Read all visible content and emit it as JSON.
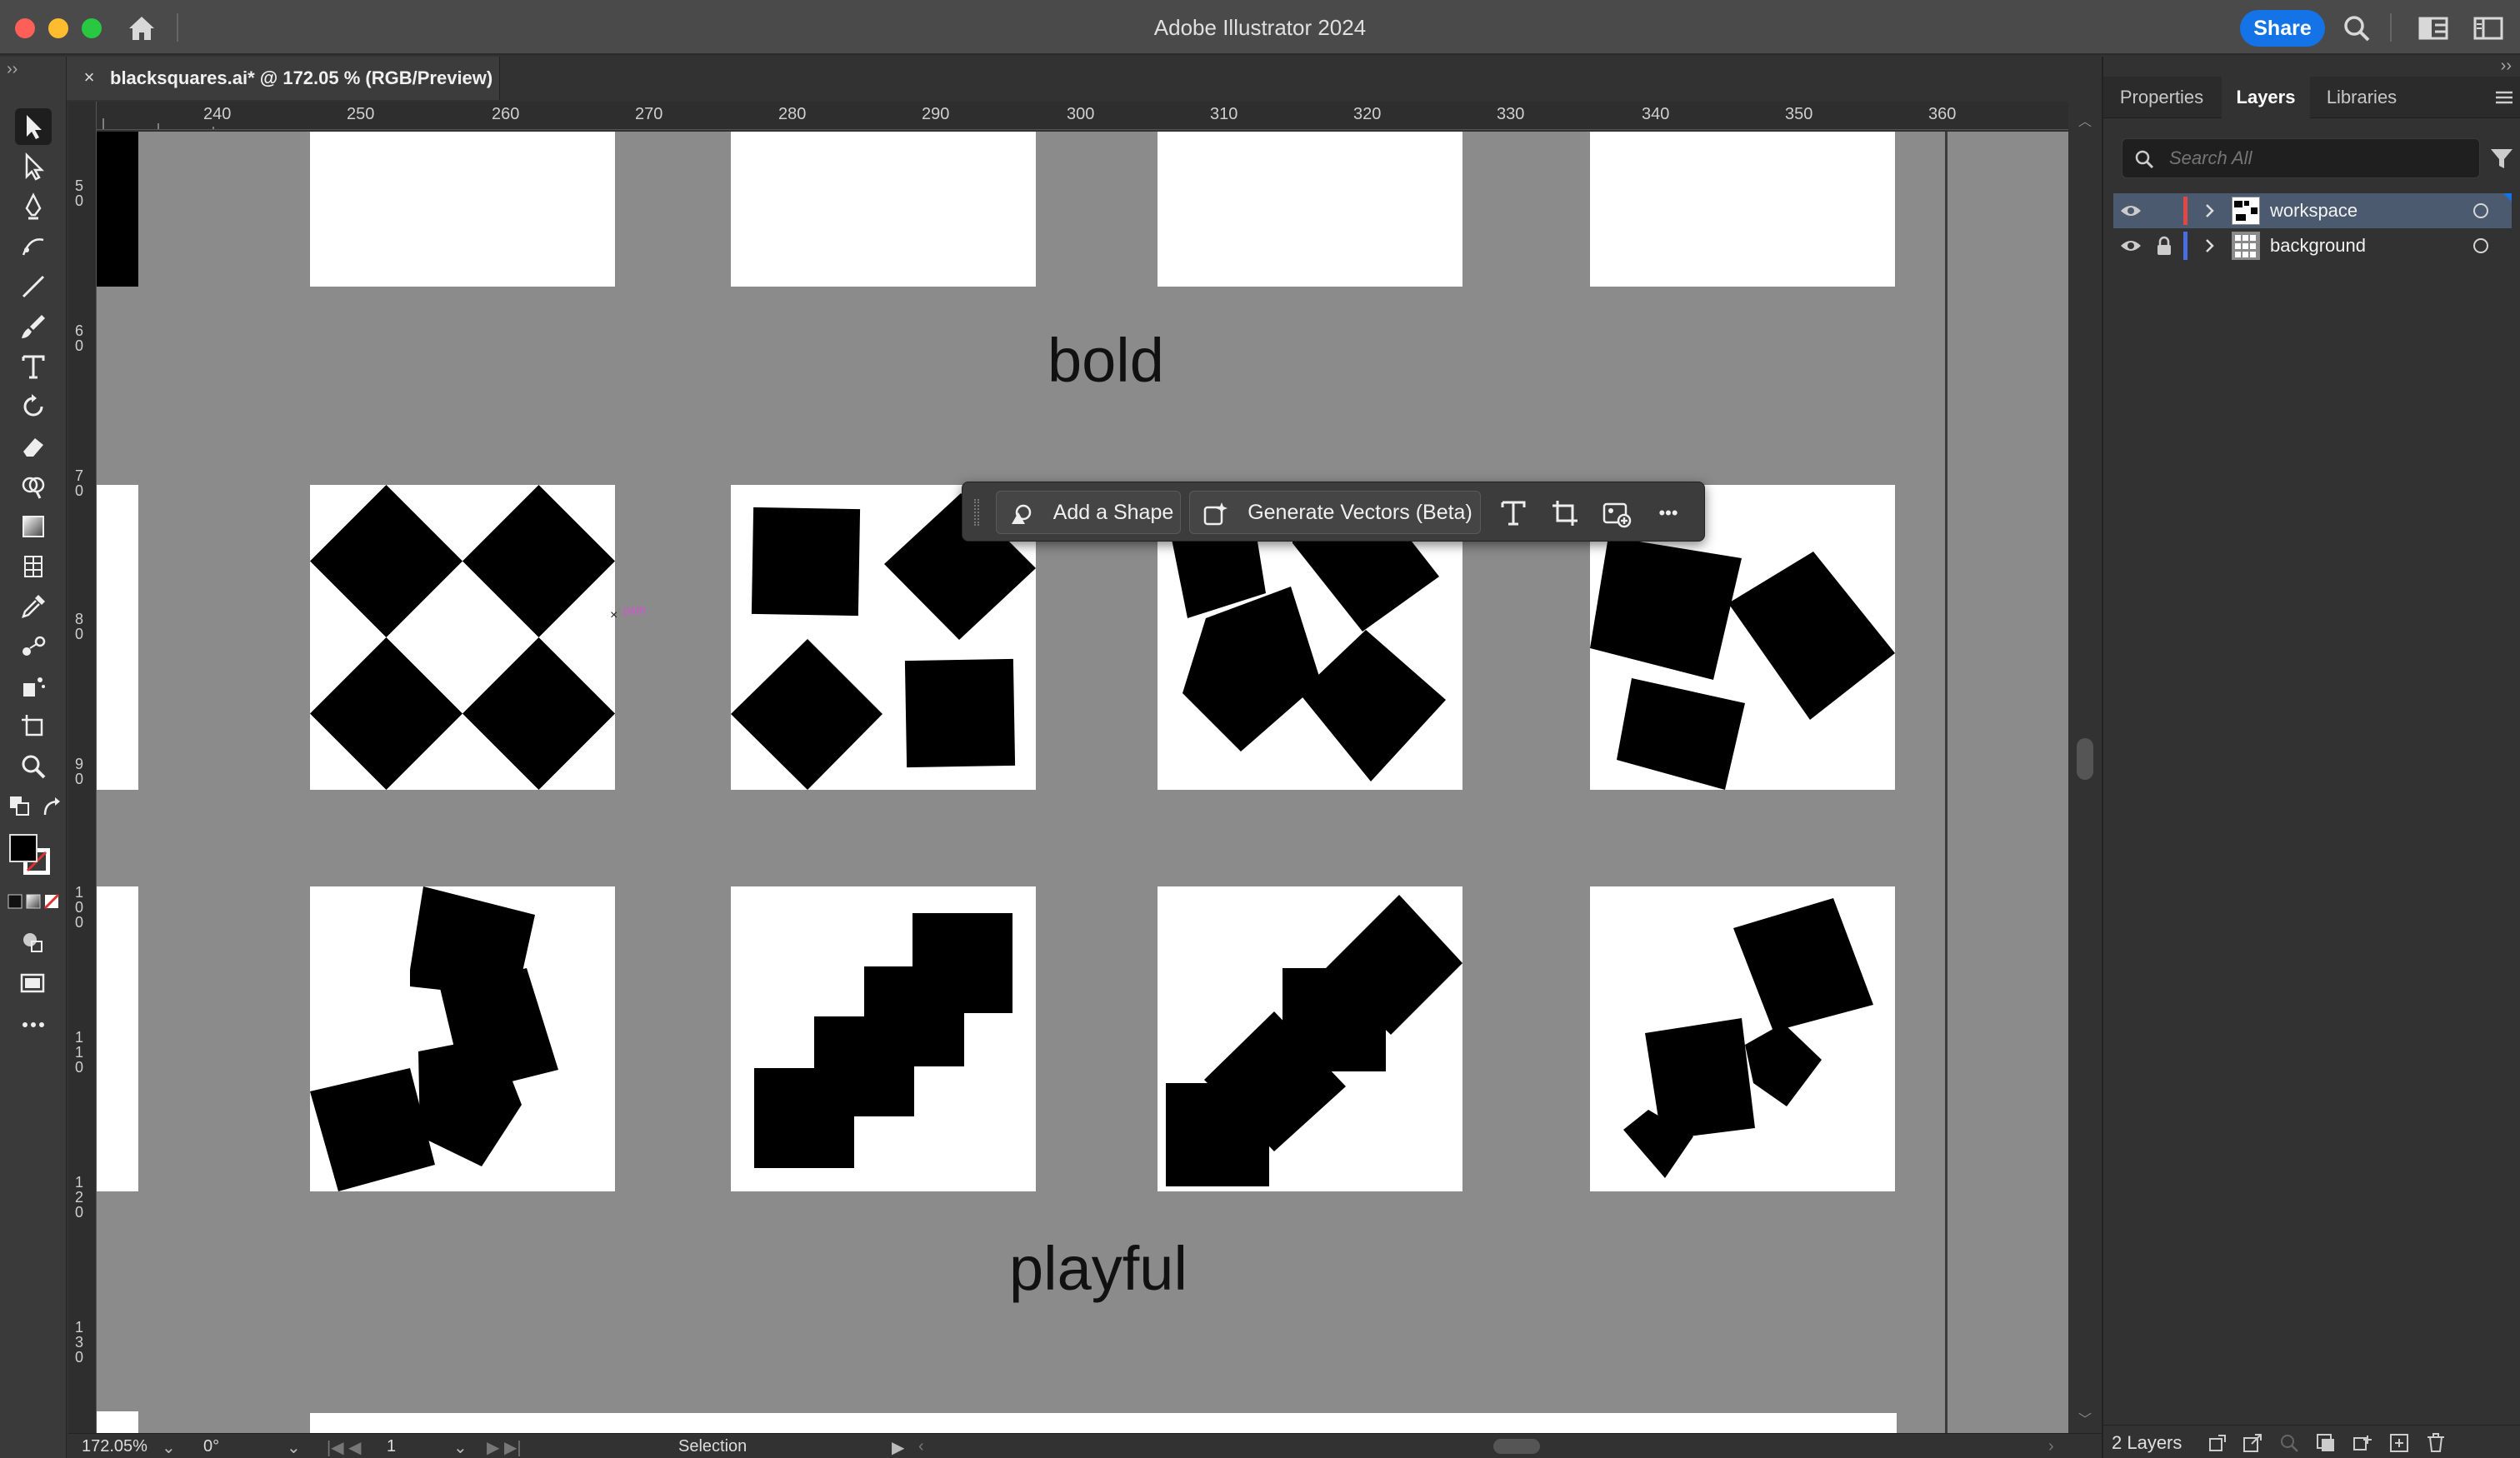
{
  "app": {
    "title": "Adobe Illustrator 2024",
    "share_label": "Share"
  },
  "document": {
    "tab_label": "blacksquares.ai* @ 172.05 % (RGB/Preview)",
    "close_glyph": "×"
  },
  "rulers": {
    "top": [
      "240",
      "250",
      "260",
      "270",
      "280",
      "290",
      "300",
      "310",
      "320",
      "330",
      "340",
      "350",
      "360"
    ],
    "left": [
      "50",
      "60",
      "70",
      "80",
      "90",
      "100",
      "110",
      "120",
      "130"
    ]
  },
  "canvas": {
    "texts": [
      "bold",
      "playful"
    ],
    "path_hint": "path"
  },
  "task_bar": {
    "add_shape": "Add a Shape",
    "generate_vectors": "Generate Vectors (Beta)",
    "more": "•••"
  },
  "status_bar": {
    "zoom": "172.05%",
    "rotation": "0°",
    "artboard": "1",
    "tool": "Selection"
  },
  "panel": {
    "tabs": [
      "Properties",
      "Layers",
      "Libraries"
    ],
    "active_tab": "Layers",
    "search_placeholder": "Search All",
    "layers": [
      {
        "name": "workspace",
        "color": "#e04848",
        "locked": false,
        "selected": true
      },
      {
        "name": "background",
        "color": "#4a6ee0",
        "locked": true,
        "selected": false
      }
    ],
    "layer_count": "2 Layers"
  },
  "colors": {
    "accent": "#1473e6",
    "canvas_gray": "#8b8b8b"
  },
  "icons": {
    "tools": [
      "selection-tool-icon",
      "direct-selection-tool-icon",
      "pen-tool-icon",
      "curvature-tool-icon",
      "line-tool-icon",
      "paintbrush-tool-icon",
      "type-tool-icon",
      "rotate-tool-icon",
      "eraser-tool-icon",
      "shape-builder-tool-icon",
      "gradient-tool-icon",
      "eyedropper-tool-icon",
      "blend-tool-icon",
      "puppet-warp-tool-icon",
      "symbol-sprayer-tool-icon",
      "artboard-tool-icon",
      "zoom-tool-icon"
    ]
  }
}
